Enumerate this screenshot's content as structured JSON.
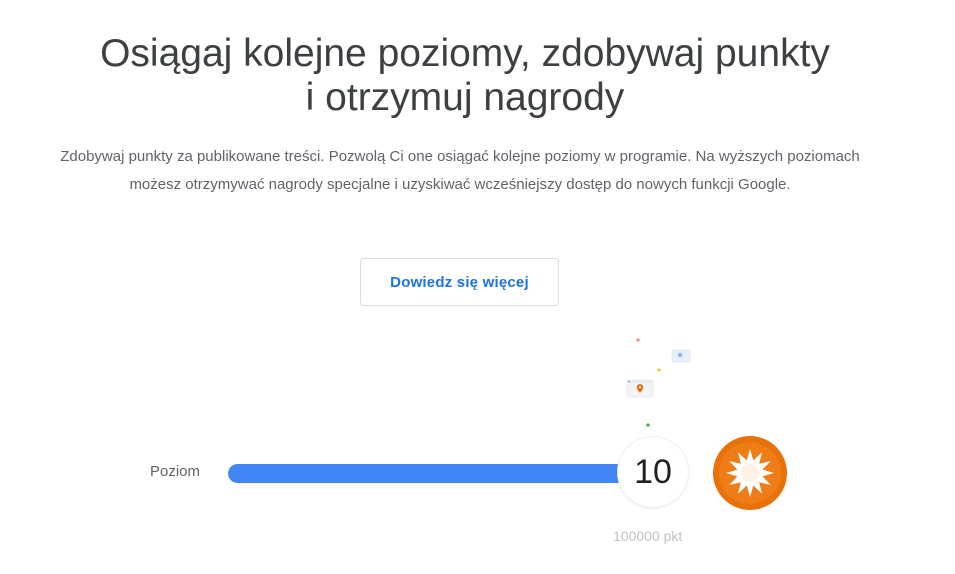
{
  "header": {
    "title_line1": "Osiągaj kolejne poziomy, zdobywaj punkty",
    "title_line2": "i otrzymuj nagrody"
  },
  "intro": {
    "text": "Zdobywaj punkty za publikowane treści. Pozwolą Ci one osiągać kolejne poziomy w programie. Na wyższych poziomach możesz otrzymywać nagrody specjalne i uzyskiwać wcześniejszy dostęp do nowych funkcji Google."
  },
  "actions": {
    "learn_more_label": "Dowiedz się więcej"
  },
  "level": {
    "label": "Poziom",
    "value": "10",
    "points": "100000 pkt",
    "progress_fraction": 1.0,
    "progress_color": "#4285f4",
    "badge_color": "#e8710a",
    "badge_icon": "starburst-badge-icon"
  },
  "colors": {
    "accent": "#1a73e8",
    "heading": "#3c4043",
    "muted": "#5f6368"
  }
}
